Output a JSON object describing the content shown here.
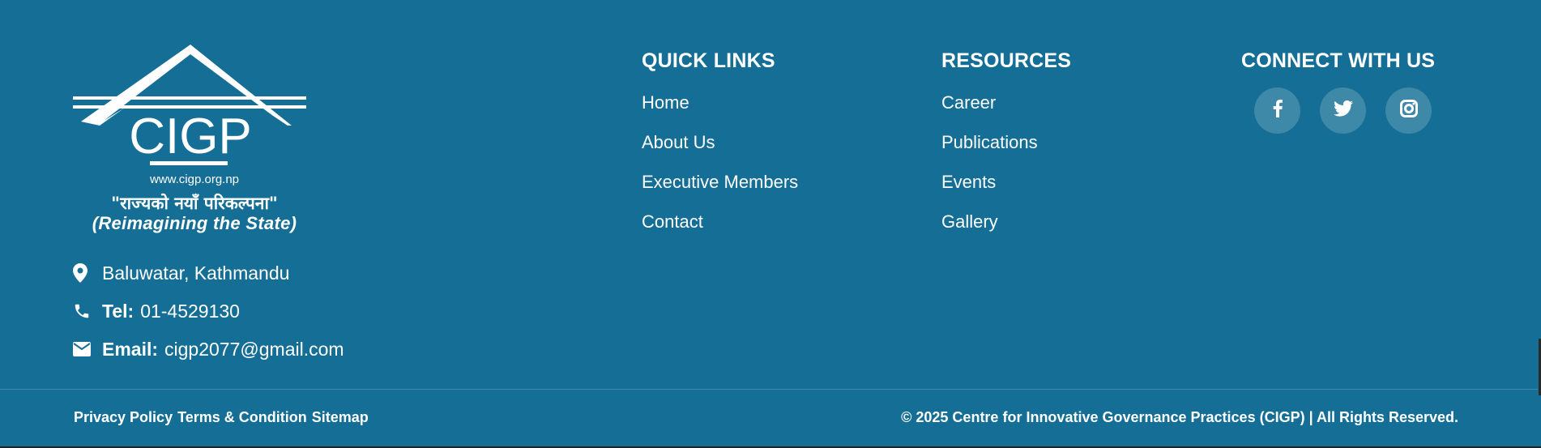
{
  "logo": {
    "name": "CIGP",
    "url": "www.cigp.org.np",
    "slogan_np": "\"राज्यको नयाँ परिकल्पना\"",
    "slogan_en": "(Reimagining the State)"
  },
  "contact": {
    "address": "Baluwatar, Kathmandu",
    "tel_label": "Tel:",
    "tel_value": "01-4529130",
    "email_label": "Email:",
    "email_value": "cigp2077@gmail.com"
  },
  "quick_links": {
    "title": "QUICK LINKS",
    "items": [
      "Home",
      "About Us",
      "Executive Members",
      "Contact"
    ]
  },
  "resources": {
    "title": "RESOURCES",
    "items": [
      "Career",
      "Publications",
      "Events",
      "Gallery"
    ]
  },
  "connect": {
    "title": "CONNECT WITH US",
    "icons": [
      "facebook-icon",
      "twitter-icon",
      "instagram-icon"
    ]
  },
  "bottom": {
    "links": [
      "Privacy Policy",
      "Terms & Condition",
      "Sitemap"
    ],
    "copyright": "© 2025 Centre for Innovative Governance Practices (CIGP) | All Rights Reserved."
  },
  "colors": {
    "background": "#146e95",
    "text": "#ffffff"
  }
}
